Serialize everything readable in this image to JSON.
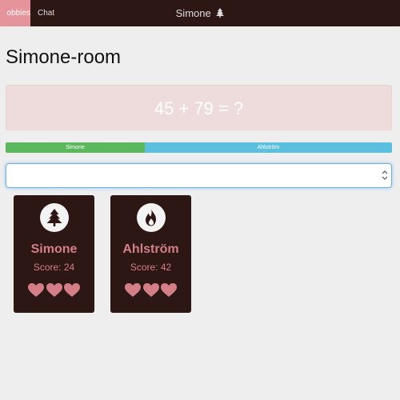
{
  "navbar": {
    "tabs": [
      {
        "label": "Lobbies",
        "visible_label": "obbies",
        "active": true
      },
      {
        "label": "Chat",
        "active": false
      }
    ],
    "user_label": "Simone",
    "user_icon": "tree-icon"
  },
  "room": {
    "title": "Simone-room"
  },
  "question": {
    "text": "45 + 79 = ?"
  },
  "progress": {
    "segments": [
      {
        "label": "Simone",
        "fraction": 0.36,
        "color": "#5cb85c"
      },
      {
        "label": "Ahlström",
        "fraction": 0.64,
        "color": "#5bc0de"
      }
    ]
  },
  "answer": {
    "value": "",
    "placeholder": ""
  },
  "players": [
    {
      "name": "Simone",
      "score_text": "Score: 24",
      "score": 24,
      "icon": "tree-icon",
      "lives": 3
    },
    {
      "name": "Ahlström",
      "score_text": "Score: 42",
      "score": 42,
      "icon": "fire-icon",
      "lives": 3
    }
  ],
  "colors": {
    "navbar_bg": "#2d1715",
    "active_tab": "#e5949c",
    "card_bg": "#2d1715",
    "accent": "#d47e87",
    "question_bg": "#eedcdc"
  }
}
